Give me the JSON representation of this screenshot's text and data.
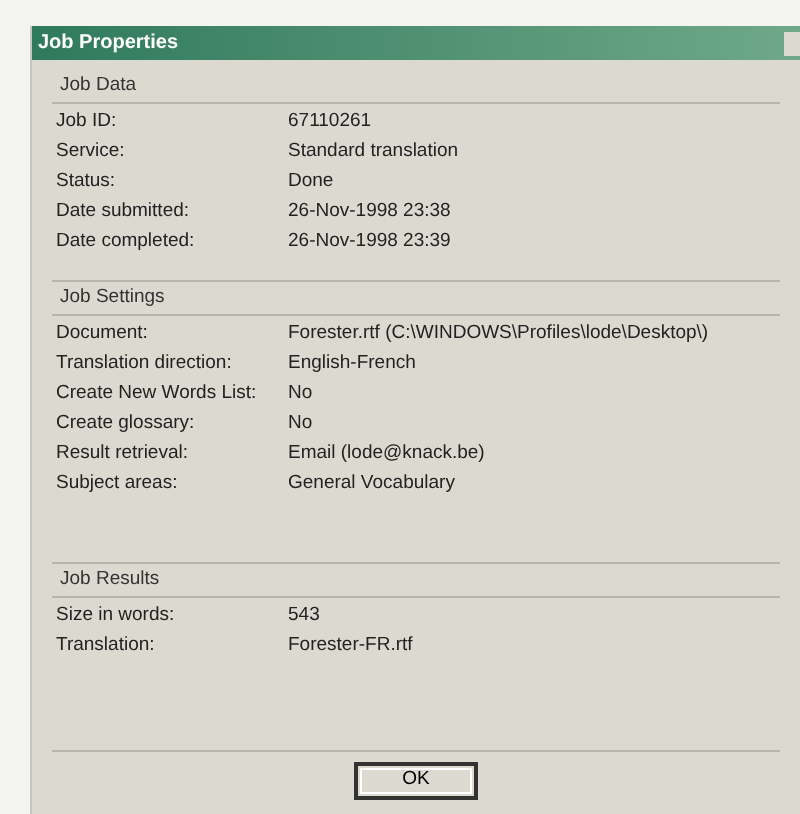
{
  "window": {
    "title": "Job Properties"
  },
  "sections": [
    {
      "title": "Job Data",
      "rows": [
        {
          "label": "Job ID:",
          "value": "67110261"
        },
        {
          "label": "Service:",
          "value": "Standard translation"
        },
        {
          "label": "Status:",
          "value": "Done"
        },
        {
          "label": "Date submitted:",
          "value": "26-Nov-1998  23:38"
        },
        {
          "label": "Date completed:",
          "value": "26-Nov-1998  23:39"
        }
      ]
    },
    {
      "title": "Job Settings",
      "rows": [
        {
          "label": "Document:",
          "value": "Forester.rtf (C:\\WINDOWS\\Profiles\\lode\\Desktop\\)"
        },
        {
          "label": "Translation direction:",
          "value": "English-French"
        },
        {
          "label": "Create New Words List:",
          "value": "No"
        },
        {
          "label": "Create glossary:",
          "value": "No"
        },
        {
          "label": "Result retrieval:",
          "value": "Email (lode@knack.be)"
        },
        {
          "label": "Subject areas:",
          "value": "General Vocabulary"
        }
      ]
    },
    {
      "title": "Job Results",
      "rows": [
        {
          "label": "Size in words:",
          "value": "543"
        },
        {
          "label": "Translation:",
          "value": "Forester-FR.rtf"
        }
      ]
    }
  ],
  "buttons": [
    "OK"
  ]
}
